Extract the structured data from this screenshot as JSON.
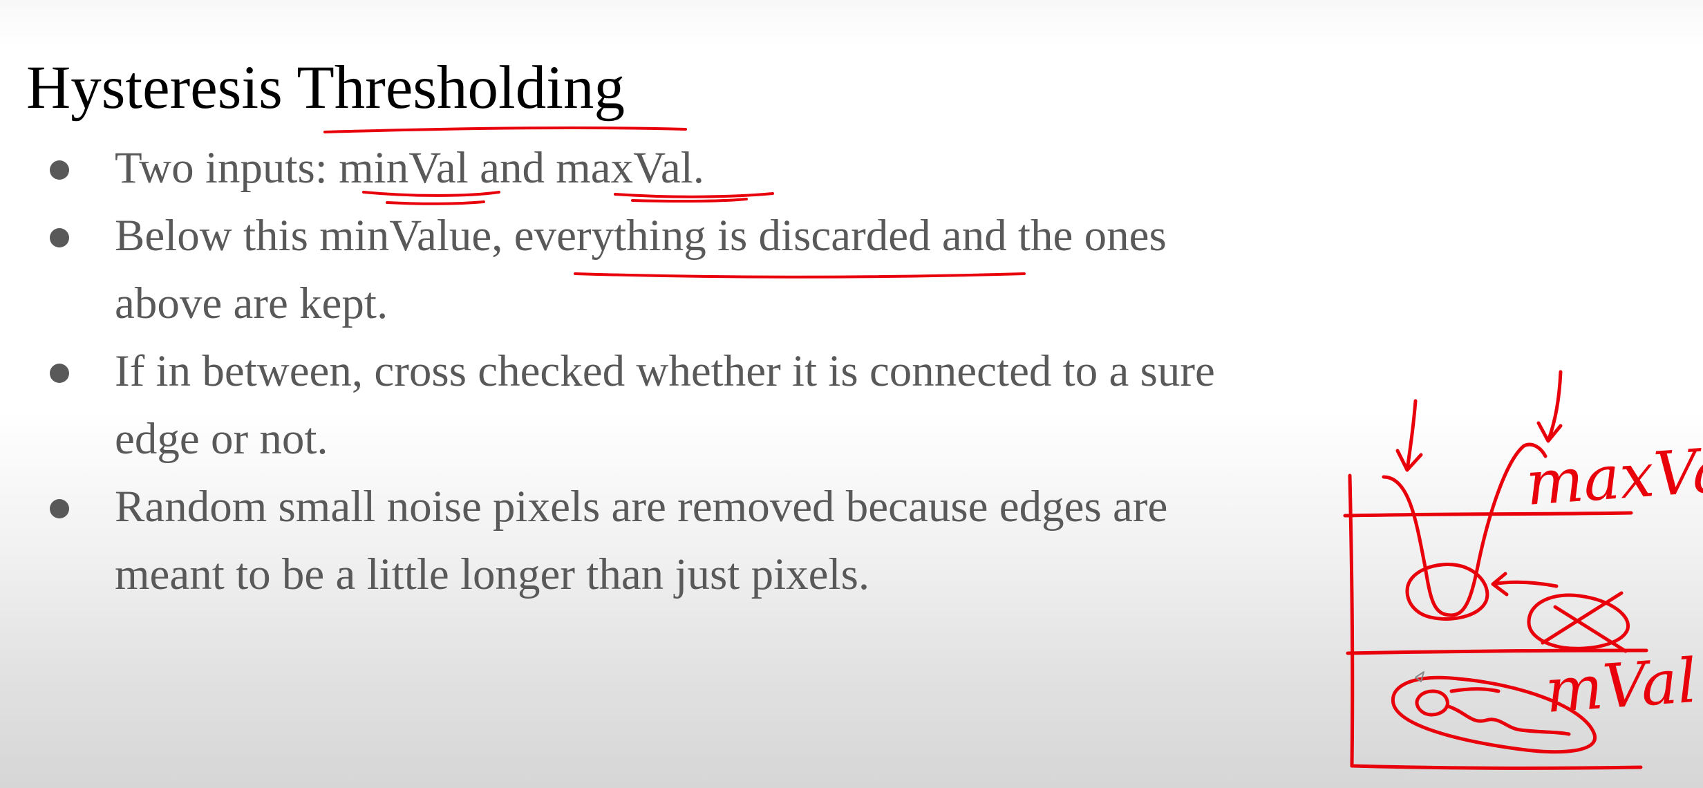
{
  "slide": {
    "title": "Hysteresis Thresholding",
    "bullets": [
      {
        "text": "Two inputs: minVal and maxVal."
      },
      {
        "text": "Below this minValue, everything is discarded and the ones\nabove are kept."
      },
      {
        "text": "If in between, cross checked whether it is connected to a sure\nedge or not."
      },
      {
        "text": "Random small noise pixels are removed because edges are\nmeant to be a little longer than just pixels."
      }
    ]
  },
  "sketch": {
    "upper_label": "maxVal",
    "lower_label": "mVal",
    "ink_color": "#e8000b"
  },
  "colors": {
    "title": "#000000",
    "body_text": "#595959",
    "annotation": "#e8000b"
  }
}
